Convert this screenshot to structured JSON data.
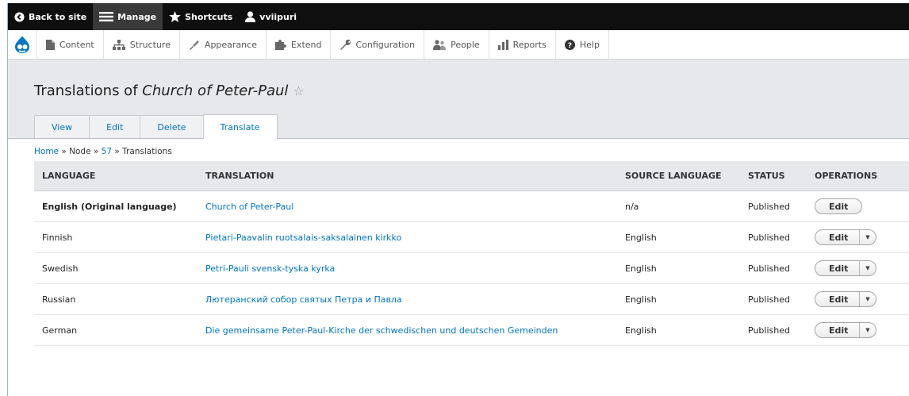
{
  "toolbar": {
    "back": "Back to site",
    "manage": "Manage",
    "shortcuts": "Shortcuts",
    "user": "vviipuri"
  },
  "menu": {
    "items": [
      "Content",
      "Structure",
      "Appearance",
      "Extend",
      "Configuration",
      "People",
      "Reports",
      "Help"
    ]
  },
  "page": {
    "title_prefix": "Translations of ",
    "title_node": "Church of Peter-Paul",
    "tabs": [
      "View",
      "Edit",
      "Delete",
      "Translate"
    ],
    "active_tab": "Translate"
  },
  "breadcrumb": {
    "home": "Home",
    "sep": " » ",
    "node": "Node",
    "id": "57",
    "current": "Translations"
  },
  "table": {
    "headers": [
      "Language",
      "Translation",
      "Source language",
      "Status",
      "Operations"
    ],
    "rows": [
      {
        "language": "English (Original language)",
        "translation": "Church of Peter-Paul",
        "source": "n/a",
        "status": "Published",
        "op": "Edit"
      },
      {
        "language": "Finnish",
        "translation": "Pietari-Paavalin ruotsalais-saksalainen kirkko",
        "source": "English",
        "status": "Published",
        "op": "Edit"
      },
      {
        "language": "Swedish",
        "translation": "Petri-Pauli svensk-tyska kyrka",
        "source": "English",
        "status": "Published",
        "op": "Edit"
      },
      {
        "language": "Russian",
        "translation": "Лютеранский собор святых Петра и Павла",
        "source": "English",
        "status": "Published",
        "op": "Edit"
      },
      {
        "language": "German",
        "translation": "Die gemeinsame Peter-Paul-Kirche der schwedischen und deutschen Gemeinden",
        "source": "English",
        "status": "Published",
        "op": "Edit"
      }
    ]
  },
  "colors": {
    "link": "#0074bd",
    "toolbar": "#0f0f0f",
    "header_bg": "#e6e8ec",
    "drupal_blue": "#0678be"
  }
}
